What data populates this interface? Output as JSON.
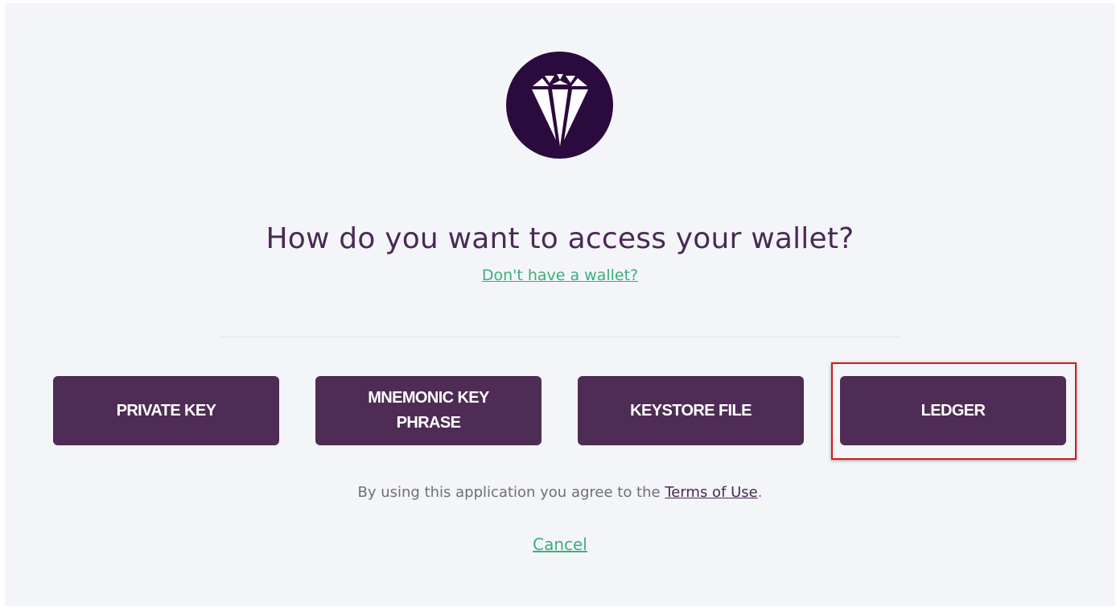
{
  "logo": {
    "icon": "diamond-icon",
    "background_color": "#2b0a3d"
  },
  "heading": "How do you want to access your wallet?",
  "no_wallet_link": "Don't have a wallet?",
  "access_options": [
    {
      "label": "PRIVATE KEY"
    },
    {
      "label": "MNEMONIC KEY PHRASE"
    },
    {
      "label": "KEYSTORE FILE"
    },
    {
      "label": "LEDGER",
      "highlighted": true
    }
  ],
  "terms": {
    "prefix": "By using this application you agree to the ",
    "link": "Terms of Use",
    "suffix": "."
  },
  "cancel_link": "Cancel",
  "colors": {
    "button": "#4e2c55",
    "link_green": "#3aae7d",
    "heading": "#4a2a55",
    "highlight_border": "#d11a1a",
    "background": "#f4f5f9"
  }
}
